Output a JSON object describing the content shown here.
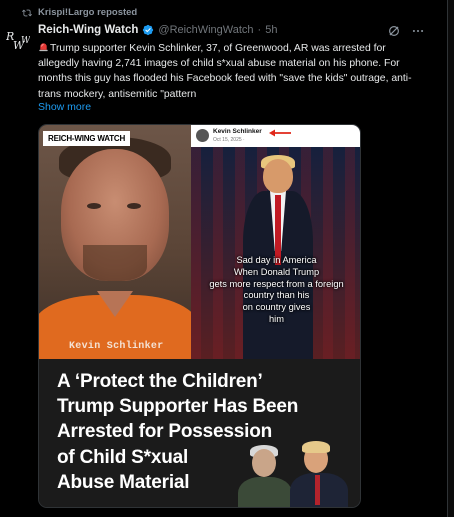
{
  "repost": {
    "label": "Krispi!Largo reposted"
  },
  "tweet": {
    "avatar_text": "RWW",
    "display_name": "Reich-Wing Watch",
    "handle": "@ReichWingWatch",
    "dot": "·",
    "time": "5h",
    "body": "Trump supporter Kevin Schlinker, 37, of Greenwood, AR was arrested for allegedly having 2,741 images of child s*xual abuse material on his phone. For months this guy has flooded his Facebook feed with \"save the kids\" outrage, anti-trans mockery, antisemitic \"pattern",
    "show_more": "Show more"
  },
  "media": {
    "left_logo": "REICH-WING WATCH",
    "left_caption": "Kevin Schlinker",
    "fb_name": "Kevin Schlinker",
    "fb_date": "Oct 15, 2025 · ",
    "meme_text": "Sad day in America\nWhen Donald Trump\ngets more respect from a foreign\ncountry  than  his\non country  gives\nhim",
    "headline": "A ‘Protect the Children’\nTrump Supporter Has Been\nArrested for Possession\nof Child S*xual\nAbuse Material"
  },
  "colors": {
    "accent": "#1d9bf0",
    "background": "#000000",
    "text": "#e7e9ea",
    "muted": "#71767b",
    "jumpsuit": "#e06a1f",
    "arrow": "#e0271a"
  },
  "icons": {
    "repost": "repost-icon",
    "verified": "verified-badge-icon",
    "siren": "siren-emoji-icon",
    "grok": "grok-icon",
    "more": "more-options-icon"
  }
}
